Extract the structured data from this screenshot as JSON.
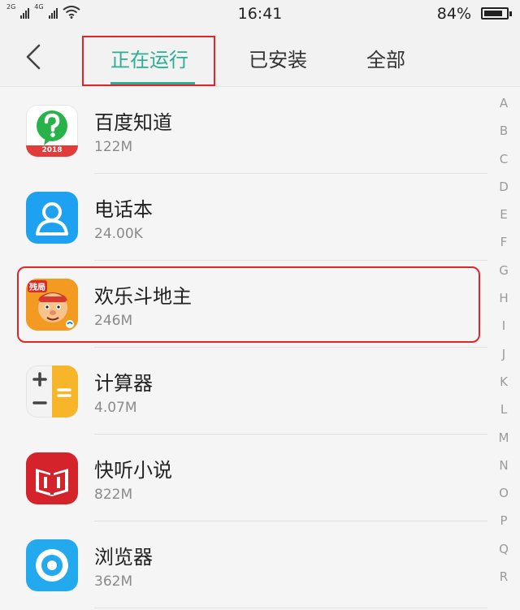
{
  "status_bar": {
    "network_1": "2G",
    "network_2": "4G",
    "time": "16:41",
    "battery_percent": "84%",
    "battery_level": 0.84
  },
  "tabs": [
    {
      "label": "正在运行",
      "active": true
    },
    {
      "label": "已安装",
      "active": false
    },
    {
      "label": "全部",
      "active": false
    }
  ],
  "apps": [
    {
      "name": "百度知道",
      "size": "122M",
      "icon": "baidu-zhidao-icon",
      "icon_badge": "2018"
    },
    {
      "name": "电话本",
      "size": "24.00K",
      "icon": "contacts-icon"
    },
    {
      "name": "欢乐斗地主",
      "size": "246M",
      "icon": "doudizhu-icon",
      "icon_badge": "残局"
    },
    {
      "name": "计算器",
      "size": "4.07M",
      "icon": "calculator-icon"
    },
    {
      "name": "快听小说",
      "size": "822M",
      "icon": "kuaiting-novel-icon"
    },
    {
      "name": "浏览器",
      "size": "362M",
      "icon": "browser-icon"
    }
  ],
  "index_letters": [
    "A",
    "B",
    "C",
    "D",
    "E",
    "F",
    "G",
    "H",
    "I",
    "J",
    "K",
    "L",
    "M",
    "N",
    "O",
    "P",
    "Q",
    "R"
  ],
  "colors": {
    "accent": "#2bae93",
    "highlight": "#e0262b",
    "background": "#f2f2f2"
  }
}
